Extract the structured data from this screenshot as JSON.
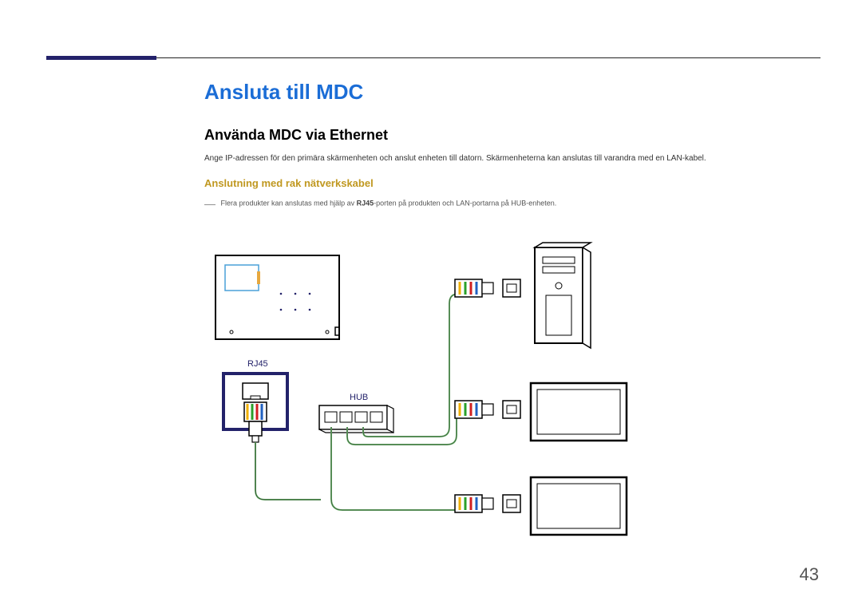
{
  "page": {
    "number": "43"
  },
  "headings": {
    "h1": "Ansluta till MDC",
    "h2": "Använda MDC via Ethernet",
    "h3": "Anslutning med rak nätverkskabel"
  },
  "paragraphs": {
    "intro": "Ange IP-adressen för den primära skärmenheten och anslut enheten till datorn. Skärmenheterna kan anslutas till varandra med en LAN-kabel.",
    "note_pre": "Flera produkter kan anslutas med hjälp av ",
    "note_bold": "RJ45",
    "note_post": "-porten på produkten och LAN-portarna på HUB-enheten."
  },
  "labels": {
    "rj45": "RJ45",
    "hub": "HUB"
  }
}
